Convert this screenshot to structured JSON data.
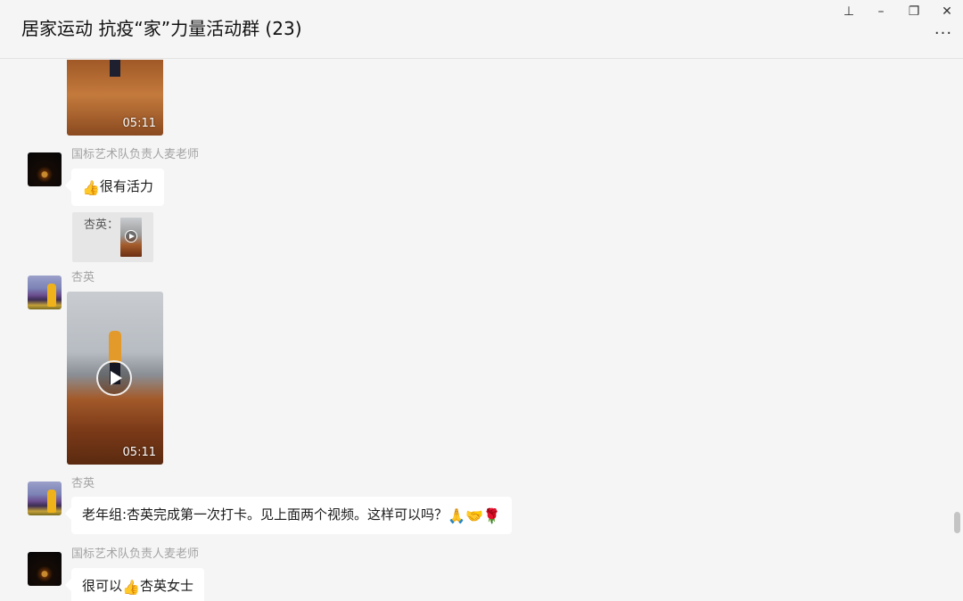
{
  "window": {
    "title": "居家运动 抗疫“家”力量活动群 (23)",
    "controls": {
      "pin": "⊥",
      "minimize": "–",
      "restore": "❐",
      "close": "✕"
    },
    "more": "···"
  },
  "messages": [
    {
      "type": "video",
      "duration": "05:11"
    },
    {
      "sender": "国标艺术队负责人麦老师",
      "text_icon": "👍",
      "text": "很有活力"
    },
    {
      "quote_label": "杏英："
    },
    {
      "sender": "杏英",
      "type": "video",
      "duration": "05:11"
    },
    {
      "sender": "杏英",
      "text": "老年组:杏英完成第一次打卡。见上面两个视频。这样可以吗？",
      "emojis": "🙏🤝🌹"
    },
    {
      "sender": "国标艺术队负责人麦老师",
      "text_a": "很可以",
      "text_icon": "👍",
      "text_b": "杏英女士"
    }
  ],
  "colors": {
    "background": "#f5f5f5",
    "bubble": "#ffffff",
    "sender": "#a3a3a3"
  }
}
